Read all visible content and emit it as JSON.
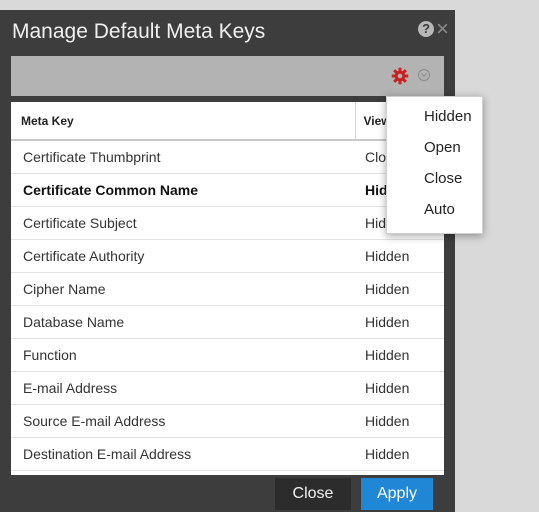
{
  "dialog": {
    "title": "Manage Default Meta Keys"
  },
  "icons": {
    "help": "help-icon",
    "close": "close-icon",
    "gear": "gear-icon",
    "gear_color": "#cc1f1f",
    "caret": "chevron-down-icon"
  },
  "table": {
    "headers": {
      "meta_key": "Meta Key",
      "view": "View"
    },
    "rows": [
      {
        "meta_key": "Certificate Thumbprint",
        "view": "Close"
      },
      {
        "meta_key": "Certificate Common Name",
        "view": "Hidden"
      },
      {
        "meta_key": "Certificate Subject",
        "view": "Hidden"
      },
      {
        "meta_key": "Certificate Authority",
        "view": "Hidden"
      },
      {
        "meta_key": "Cipher Name",
        "view": "Hidden"
      },
      {
        "meta_key": "Database Name",
        "view": "Hidden"
      },
      {
        "meta_key": "Function",
        "view": "Hidden"
      },
      {
        "meta_key": "E-mail Address",
        "view": "Hidden"
      },
      {
        "meta_key": "Source E-mail Address",
        "view": "Hidden"
      },
      {
        "meta_key": "Destination E-mail Address",
        "view": "Hidden"
      }
    ]
  },
  "menu": {
    "items": [
      "Hidden",
      "Open",
      "Close",
      "Auto"
    ]
  },
  "footer": {
    "close_label": "Close",
    "apply_label": "Apply"
  },
  "colors": {
    "dialog_bg": "#3d3d3d",
    "toolbar_bg": "#b3b3b3",
    "apply_bg": "#1f87d6"
  }
}
